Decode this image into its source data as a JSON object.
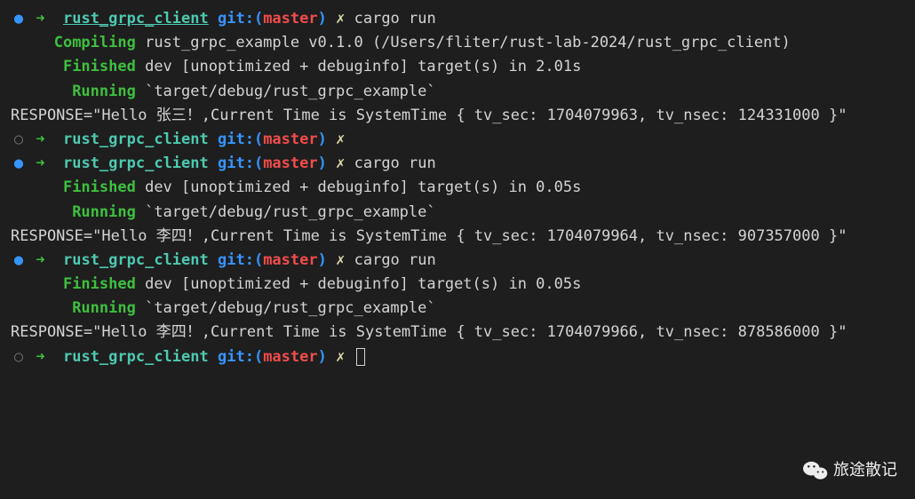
{
  "prompt": {
    "arrow": "➜",
    "dir": "rust_grpc_client",
    "git_label": "git:(",
    "branch": "master",
    "close_paren": ")",
    "x": "✗"
  },
  "commands": {
    "cargo_run": "cargo run"
  },
  "runs": [
    {
      "compiling": "Compiling",
      "compile_text": " rust_grpc_example v0.1.0 (/Users/fliter/rust-lab-2024/rust_grpc_client)",
      "finished": "Finished",
      "finished_text": " dev [unoptimized + debuginfo] target(s) in 2.01s",
      "running": "Running",
      "running_text": " `target/debug/rust_grpc_example`",
      "response": "RESPONSE=\"Hello 张三！,Current Time is SystemTime { tv_sec: 1704079963, tv_nsec: 124331000 }\""
    },
    {
      "finished": "Finished",
      "finished_text": " dev [unoptimized + debuginfo] target(s) in 0.05s",
      "running": "Running",
      "running_text": " `target/debug/rust_grpc_example`",
      "response": "RESPONSE=\"Hello 李四！,Current Time is SystemTime { tv_sec: 1704079964, tv_nsec: 907357000 }\""
    },
    {
      "finished": "Finished",
      "finished_text": " dev [unoptimized + debuginfo] target(s) in 0.05s",
      "running": "Running",
      "running_text": " `target/debug/rust_grpc_example`",
      "response": "RESPONSE=\"Hello 李四！,Current Time is SystemTime { tv_sec: 1704079966, tv_nsec: 878586000 }\""
    }
  ],
  "watermark": "旅途散记"
}
